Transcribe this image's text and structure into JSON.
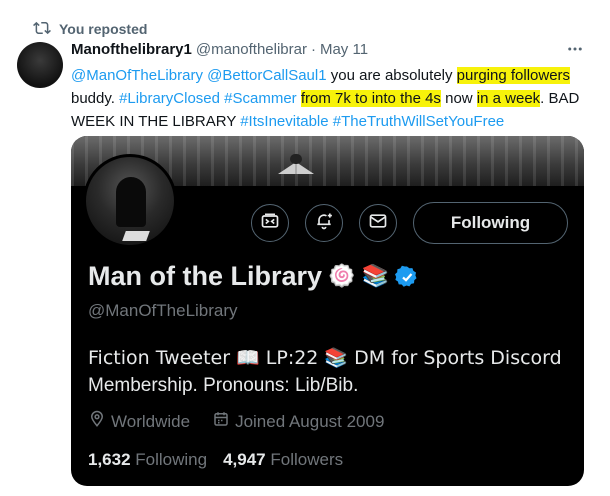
{
  "repost": {
    "label": "You reposted",
    "icon": "repost-icon"
  },
  "tweet": {
    "display_name": "Manofthelibrary1",
    "handle": "@manofthelibrar",
    "separator": "·",
    "date": "May 11",
    "more_icon": "more-icon",
    "text": {
      "mention1": "@ManOfTheLibrary",
      "mention2": "@BettorCallSaul1",
      "t1": " you are absolutely ",
      "hl1": "purging followers",
      "t2": " buddy. ",
      "tag1": "#LibraryClosed",
      "tag2": "#Scammer",
      "hl2": "from 7k to into the 4s",
      "t3": " now ",
      "hl3": "in a week",
      "t4": ". BAD WEEK IN THE LIBRARY ",
      "tag3": "#ItsInevitable",
      "tag4": "#TheTruthWillSetYouFree"
    }
  },
  "profile_card": {
    "display_name": "Man of the Library",
    "emoji1": "🍥",
    "emoji2": "📚",
    "handle": "@ManOfTheLibrary",
    "following_button": "Following",
    "buttons": [
      "media-icon",
      "notify-icon",
      "message-icon"
    ],
    "bio_line1": "Fiction Tweeter 📖 LP:22 📚 DM for Sports Discord",
    "bio_line2": "Membership. Pronouns: Lib/Bib.",
    "location": "Worldwide",
    "joined": "Joined August 2009",
    "following_count": "1,632",
    "following_label": "Following",
    "followers_count": "4,947",
    "followers_label": "Followers",
    "colors": {
      "accent": "#1d9bf0",
      "highlight": "#f7f20a",
      "card_bg": "#000000"
    }
  }
}
